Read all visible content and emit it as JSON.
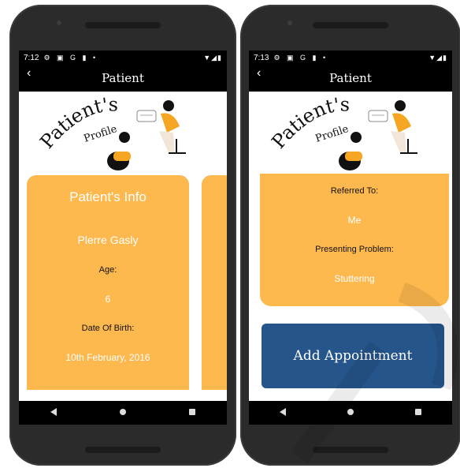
{
  "left_phone": {
    "status": {
      "time": "7:12",
      "icons": "⚙ ▣ G ▮ •",
      "right_icons": "▼◢▮"
    },
    "appbar": {
      "title": "Patient"
    },
    "banner": {
      "logo_line1": "Patient's",
      "logo_line2": "Profile"
    },
    "card": {
      "title": "Patient's Info",
      "name": "Plerre Gasly",
      "age_label": "Age:",
      "age_value": "6",
      "dob_label": "Date Of Birth:",
      "dob_value": "10th February, 2016"
    }
  },
  "right_phone": {
    "status": {
      "time": "7:13",
      "icons": "⚙ ▣ G ▮ •",
      "right_icons": "▼◢▮"
    },
    "appbar": {
      "title": "Patient"
    },
    "banner": {
      "logo_line1": "Patient's",
      "logo_line2": "Profile"
    },
    "card": {
      "referred_label": "Referred To:",
      "referred_value": "Me",
      "problem_label": "Presenting Problem:",
      "problem_value": "Stuttering"
    },
    "button": {
      "label": "Add Appointment"
    }
  },
  "colors": {
    "card": "#fdb84e",
    "button": "#25558a",
    "bar": "#000000"
  },
  "icons": [
    "back-arrow-icon",
    "nav-back-icon",
    "nav-home-icon",
    "nav-recent-icon"
  ]
}
